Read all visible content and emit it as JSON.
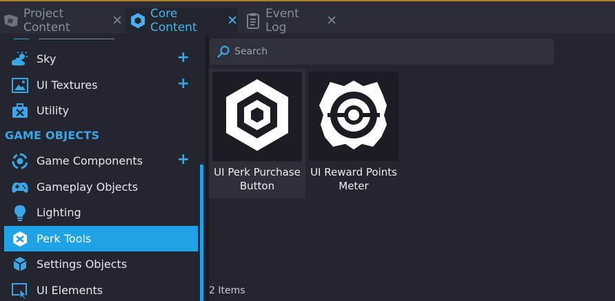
{
  "tabs": [
    {
      "label": "Project Content",
      "icon": "project-content-icon",
      "active": false
    },
    {
      "label": "Core Content",
      "icon": "core-content-icon",
      "active": true
    },
    {
      "label": "Event Log",
      "icon": "clipboard-icon",
      "active": false
    }
  ],
  "close_glyph": "✕",
  "sidebar": {
    "items_top": [
      {
        "label": "Sky",
        "icon": "cloud-sun-icon",
        "has_add": true
      },
      {
        "label": "UI Textures",
        "icon": "image-icon",
        "has_add": true
      },
      {
        "label": "Utility",
        "icon": "toolbox-icon",
        "has_add": false
      }
    ],
    "section_title": "GAME OBJECTS",
    "items_bottom": [
      {
        "label": "Game Components",
        "icon": "component-cycle-icon",
        "has_add": true
      },
      {
        "label": "Gameplay Objects",
        "icon": "gamepad-icon",
        "has_add": false
      },
      {
        "label": "Lighting",
        "icon": "lightbulb-icon",
        "has_add": false
      },
      {
        "label": "Perk Tools",
        "icon": "perk-icon",
        "has_add": false,
        "selected": true
      },
      {
        "label": "Settings Objects",
        "icon": "cubes-icon",
        "has_add": false
      },
      {
        "label": "UI Elements",
        "icon": "cursor-window-icon",
        "has_add": false
      }
    ],
    "add_glyph": "+"
  },
  "search": {
    "placeholder": "Search",
    "value": "",
    "icon": "search-icon"
  },
  "assets": [
    {
      "label": "UI Perk Purchase Button",
      "icon": "perk-hex-icon"
    },
    {
      "label": "UI Reward Points Meter",
      "icon": "reward-meter-icon"
    }
  ],
  "status": {
    "count_text": "2 Items"
  },
  "colors": {
    "accent": "#1ea3e6",
    "text_active": "#4ab0ee",
    "background": "#23262e",
    "tabbar": "#2a2d35"
  }
}
